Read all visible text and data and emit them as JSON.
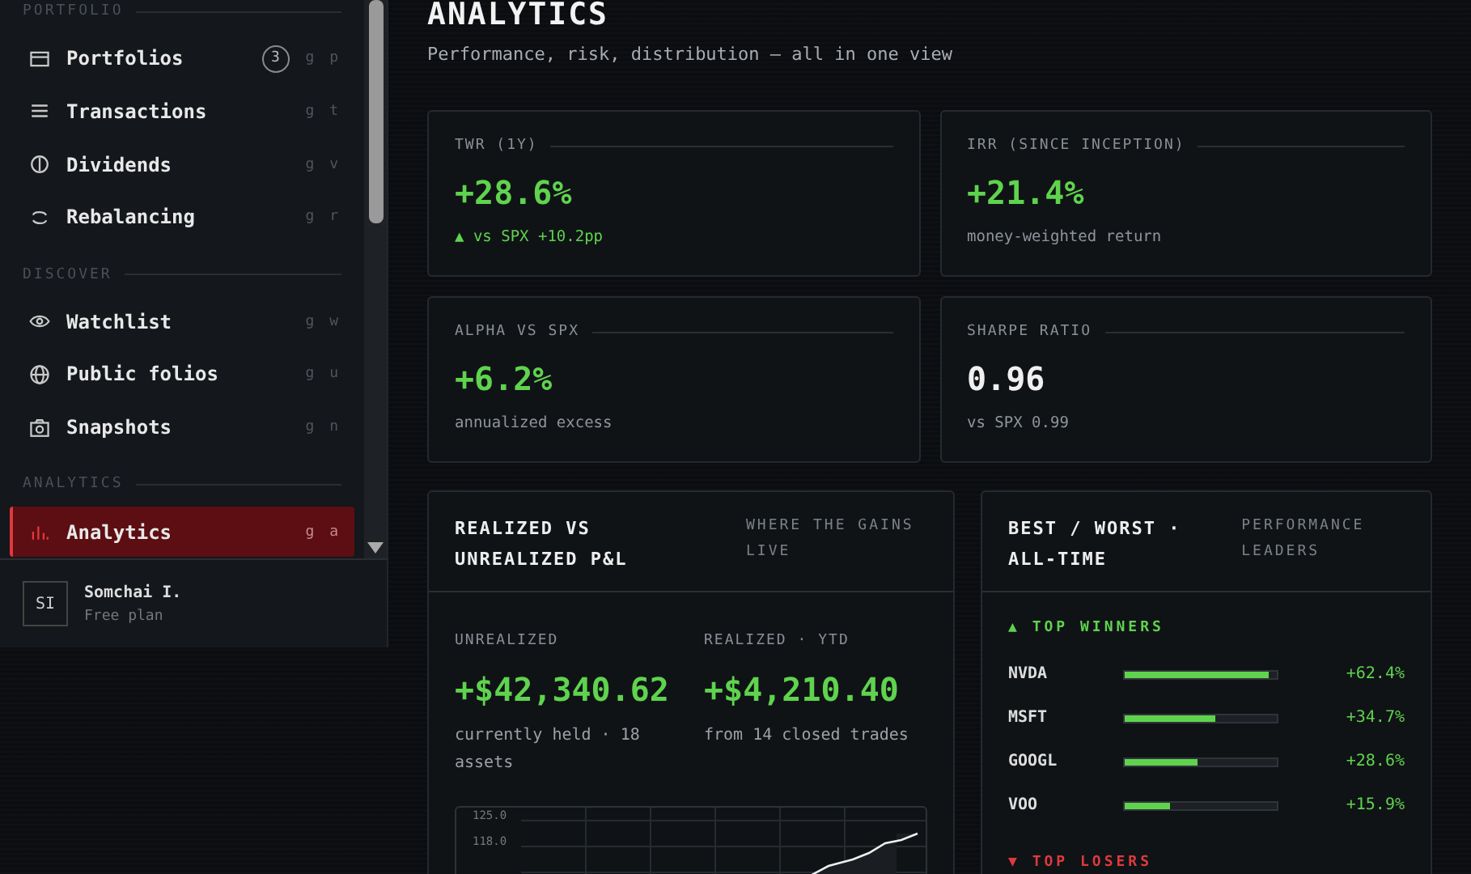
{
  "sidebar": {
    "sections": [
      {
        "label": "PORTFOLIO",
        "items": [
          {
            "kind": "card",
            "label": "Portfolios",
            "badge": "3",
            "shortcut": "g p",
            "selected": false
          },
          {
            "kind": "list",
            "label": "Transactions",
            "shortcut": "g t",
            "selected": false
          },
          {
            "kind": "coin",
            "label": "Dividends",
            "shortcut": "g v",
            "selected": false
          },
          {
            "kind": "cycle",
            "label": "Rebalancing",
            "shortcut": "g r",
            "selected": false
          }
        ]
      },
      {
        "label": "DISCOVER",
        "items": [
          {
            "kind": "eye",
            "label": "Watchlist",
            "shortcut": "g w",
            "selected": false
          },
          {
            "kind": "globe",
            "label": "Public folios",
            "shortcut": "g u",
            "selected": false
          },
          {
            "kind": "camera",
            "label": "Snapshots",
            "shortcut": "g n",
            "selected": false
          }
        ]
      },
      {
        "label": "ANALYTICS",
        "items": [
          {
            "kind": "bars",
            "label": "Analytics",
            "shortcut": "g a",
            "selected": true
          }
        ]
      }
    ],
    "user": {
      "initials": "SI",
      "name": "Somchai I.",
      "plan": "Free plan"
    }
  },
  "page": {
    "title": "ANALYTICS",
    "subtitle": "Performance, risk, distribution — all in one view"
  },
  "metrics": [
    {
      "label": "TWR (1Y)",
      "value": "+28.6%",
      "positive": true,
      "note": "▲ vs SPX +10.2pp",
      "note_positive": true
    },
    {
      "label": "IRR (SINCE INCEPTION)",
      "value": "+21.4%",
      "positive": true,
      "note": "money-weighted return",
      "note_positive": false
    },
    {
      "label": "ALPHA VS SPX",
      "value": "+6.2%",
      "positive": true,
      "note": "annualized excess",
      "note_positive": false
    },
    {
      "label": "SHARPE RATIO",
      "value": "0.96",
      "positive": false,
      "note": "vs SPX 0.99",
      "note_positive": false
    }
  ],
  "pnl": {
    "title": "REALIZED VS UNREALIZED P&L",
    "aside": "WHERE THE GAINS LIVE",
    "columns": [
      {
        "label": "UNREALIZED",
        "value": "+$42,340.62",
        "note": "currently held · 18 assets"
      },
      {
        "label": "REALIZED · YTD",
        "value": "+$4,210.40",
        "note": "from 14 closed trades"
      }
    ],
    "chart_ticks": [
      "125.0",
      "118.0"
    ]
  },
  "leaders": {
    "title": "BEST / WORST · ALL-TIME",
    "aside": "PERFORMANCE LEADERS",
    "winners_label": "▲ TOP WINNERS",
    "winners": [
      {
        "ticker": "NVDA",
        "level": 0.95,
        "change": "+62.4%"
      },
      {
        "ticker": "MSFT",
        "level": 0.6,
        "change": "+34.7%"
      },
      {
        "ticker": "GOOGL",
        "level": 0.48,
        "change": "+28.6%"
      },
      {
        "ticker": "VOO",
        "level": 0.3,
        "change": "+15.9%"
      }
    ],
    "losers_label": "▼ TOP LOSERS"
  }
}
